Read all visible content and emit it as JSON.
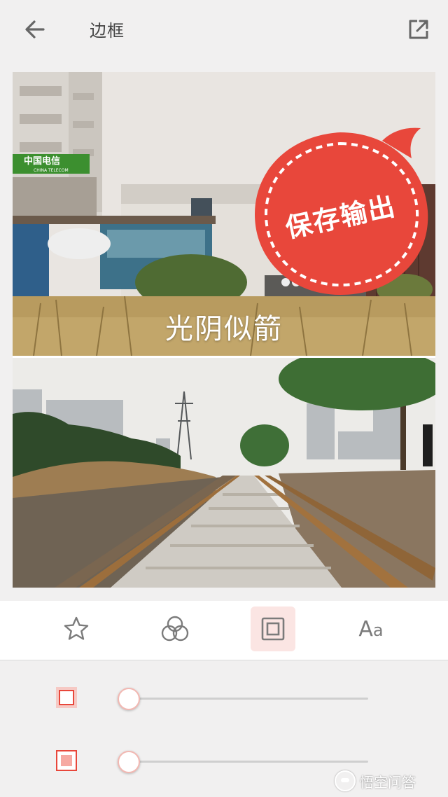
{
  "header": {
    "title": "边框"
  },
  "canvas": {
    "photo_top": {
      "caption": "光阴似箭",
      "sign_text": "中国电信",
      "sign_subtext": "CHINA TELECOM"
    },
    "badge": {
      "label": "保存输出"
    }
  },
  "toolbar": {
    "tools": [
      {
        "icon": "star-icon",
        "label": ""
      },
      {
        "icon": "filter-circles-icon",
        "label": ""
      },
      {
        "icon": "frame-icon",
        "label": "",
        "active": true
      },
      {
        "icon": "text-icon",
        "label_big": "A",
        "label_small": "a"
      }
    ]
  },
  "sliders": [
    {
      "icon": "border-outline-icon",
      "value": 0.0
    },
    {
      "icon": "border-fill-icon",
      "value": 0.0
    }
  ],
  "watermark": {
    "text": "悟空问答"
  },
  "colors": {
    "accent": "#e8473b",
    "accent_light": "#fbe5e3",
    "slider_knob_border": "#f2b8b2"
  }
}
